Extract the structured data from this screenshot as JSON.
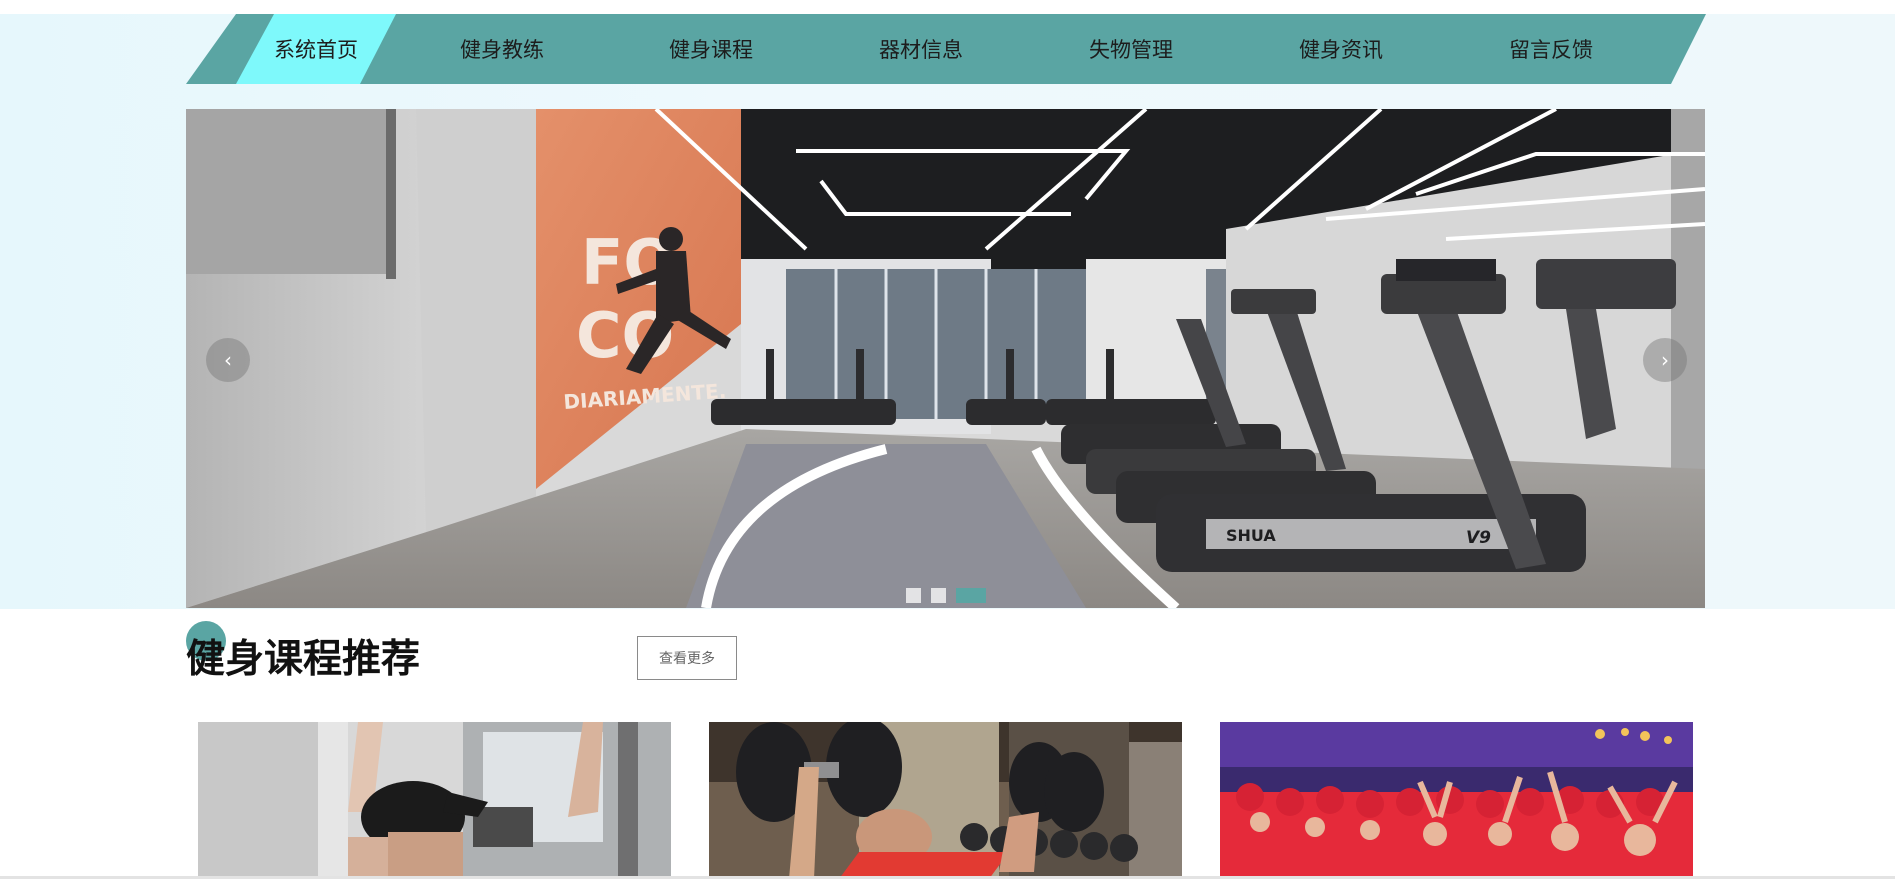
{
  "nav": {
    "items": [
      {
        "label": "系统首页",
        "active": true
      },
      {
        "label": "健身教练",
        "active": false
      },
      {
        "label": "健身课程",
        "active": false
      },
      {
        "label": "器材信息",
        "active": false
      },
      {
        "label": "失物管理",
        "active": false
      },
      {
        "label": "健身资讯",
        "active": false
      },
      {
        "label": "留言反馈",
        "active": false
      }
    ]
  },
  "banner": {
    "prev_icon": "‹",
    "next_icon": "›",
    "mural_lines": [
      "FO",
      "CO",
      "DIARIAMENTE."
    ],
    "treadmill_brand": "SHUA",
    "treadmill_model": "V9",
    "slide_count": 3,
    "active_slide": 3
  },
  "section": {
    "title": "健身课程推荐",
    "more_label": "查看更多"
  },
  "colors": {
    "accent": "#5aa5a3",
    "nav_active": "#7ef9fb",
    "page_background": "#eaf8fc"
  },
  "cards": [
    {
      "image": "man-pull-down-cap"
    },
    {
      "image": "man-dumbbell-bench-press"
    },
    {
      "image": "group-spinning-class-red-shirts"
    }
  ]
}
